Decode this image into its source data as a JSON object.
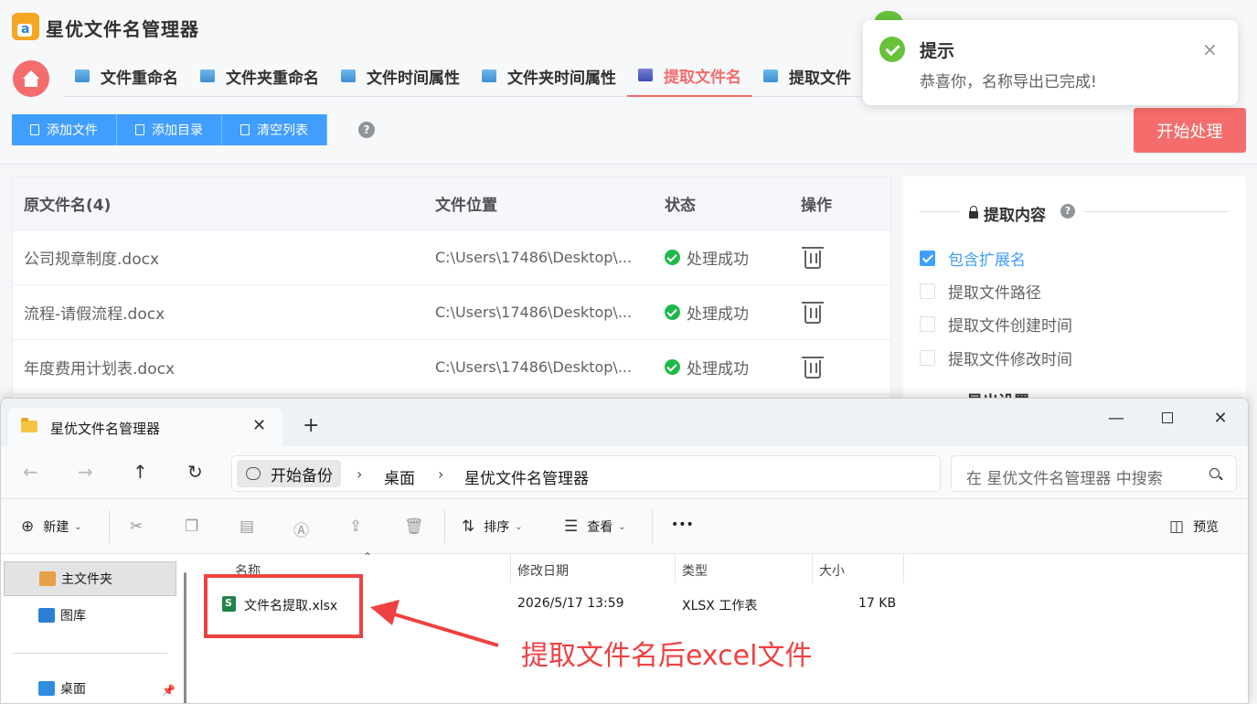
{
  "app": {
    "title": "星优文件名管理器",
    "tabs": [
      {
        "label": "文件重命名"
      },
      {
        "label": "文件夹重命名"
      },
      {
        "label": "文件时间属性"
      },
      {
        "label": "文件夹时间属性"
      },
      {
        "label": "提取文件名"
      },
      {
        "label": "提取文件"
      }
    ],
    "active_tab": "提取文件名",
    "toolbar": {
      "add_file": "添加文件",
      "add_dir": "添加目录",
      "clear_list": "清空列表",
      "help": "?"
    },
    "start_button": "开始处理",
    "table": {
      "headers": {
        "name": "原文件名(4)",
        "location": "文件位置",
        "status": "状态",
        "action": "操作"
      },
      "rows": [
        {
          "name": "公司规章制度.docx",
          "location": "C:\\Users\\17486\\Desktop\\...",
          "status": "处理成功"
        },
        {
          "name": "流程-请假流程.docx",
          "location": "C:\\Users\\17486\\Desktop\\...",
          "status": "处理成功"
        },
        {
          "name": "年度费用计划表.docx",
          "location": "C:\\Users\\17486\\Desktop\\...",
          "status": "处理成功"
        }
      ]
    },
    "side_panel": {
      "title": "提取内容",
      "help": "?",
      "options": [
        {
          "label": "包含扩展名",
          "checked": true
        },
        {
          "label": "提取文件路径",
          "checked": false
        },
        {
          "label": "提取文件创建时间",
          "checked": false
        },
        {
          "label": "提取文件修改时间",
          "checked": false
        }
      ],
      "next_section": "导出设置"
    },
    "accent_color": "#f56c6c",
    "primary_color": "#409eff"
  },
  "notification": {
    "title": "提示",
    "message": "恭喜你，名称导出已完成!",
    "close": "×",
    "icon": "success-check-icon"
  },
  "explorer": {
    "tab_title": "星优文件名管理器",
    "tab_close": "✕",
    "new_tab": "+",
    "window": {
      "minimize": "—",
      "close": "✕"
    },
    "nav": {
      "back": "←",
      "forward": "→",
      "up": "↑",
      "refresh": "↻"
    },
    "breadcrumb": [
      "开始备份",
      "桌面",
      "星优文件名管理器"
    ],
    "crumb_separator": "›",
    "search_placeholder": "在 星优文件名管理器 中搜索",
    "commands": {
      "new": "新建",
      "sort": "排序",
      "view": "查看",
      "more": "•••",
      "preview": "预览"
    },
    "sidebar": [
      {
        "label": "主文件夹",
        "icon": "home-icon"
      },
      {
        "label": "图库",
        "icon": "gallery-icon"
      },
      {
        "label": "桌面",
        "icon": "desktop-icon"
      }
    ],
    "columns": {
      "name": "名称",
      "modified": "修改日期",
      "type": "类型",
      "size": "大小"
    },
    "files": [
      {
        "name": "文件名提取.xlsx",
        "modified": "2026/5/17 13:59",
        "type": "XLSX 工作表",
        "size": "17 KB"
      }
    ]
  },
  "annotation": {
    "text": "提取文件名后excel文件",
    "color": "#ef4141"
  }
}
